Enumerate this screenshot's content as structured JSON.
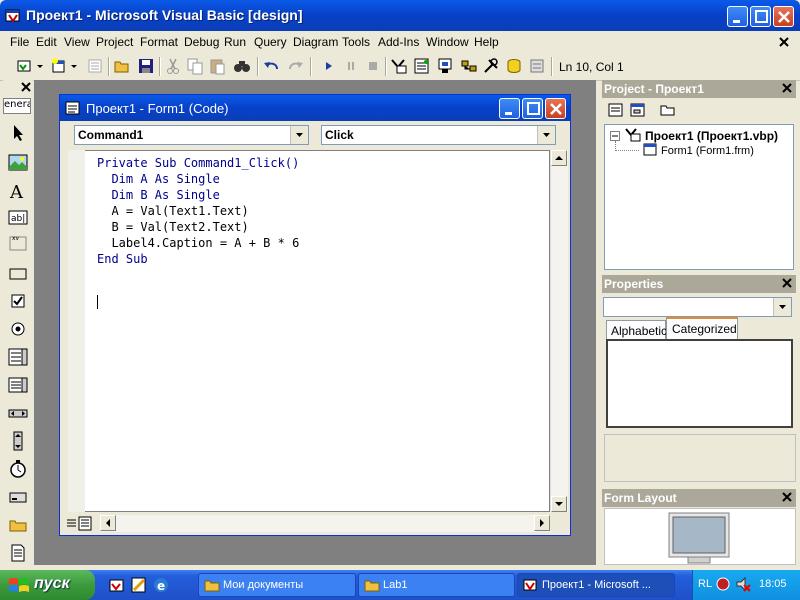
{
  "window": {
    "title": "Проект1 - Microsoft Visual Basic [design]"
  },
  "menu": [
    "File",
    "Edit",
    "View",
    "Project",
    "Format",
    "Debug",
    "Run",
    "Query",
    "Diagram",
    "Tools",
    "Add-Ins",
    "Window",
    "Help"
  ],
  "toolbar": {
    "status": "Ln 10, Col 1"
  },
  "toolbox": {
    "header": "enera"
  },
  "code_window": {
    "title": "Проект1 - Form1 (Code)",
    "object_combo": "Command1",
    "proc_combo": "Click",
    "lines": [
      "Private Sub Command1_Click()",
      "  Dim A As Single",
      "  Dim B As Single",
      "  A = Val(Text1.Text)",
      "  B = Val(Text2.Text)",
      "  Label4.Caption = A + B * 6",
      "End Sub"
    ]
  },
  "project_panel": {
    "title": "Project - Проект1",
    "root": "Проект1 (Проект1.vbp)",
    "child": "Form1 (Form1.frm)"
  },
  "properties_panel": {
    "title": "Properties",
    "tabs": [
      "Alphabetic",
      "Categorized"
    ]
  },
  "form_layout_panel": {
    "title": "Form Layout"
  },
  "taskbar": {
    "start": "пуск",
    "tasks": [
      "Мои документы",
      "Lab1",
      "Проект1 - Microsoft ..."
    ],
    "lang": "RL",
    "clock": "18:05"
  }
}
